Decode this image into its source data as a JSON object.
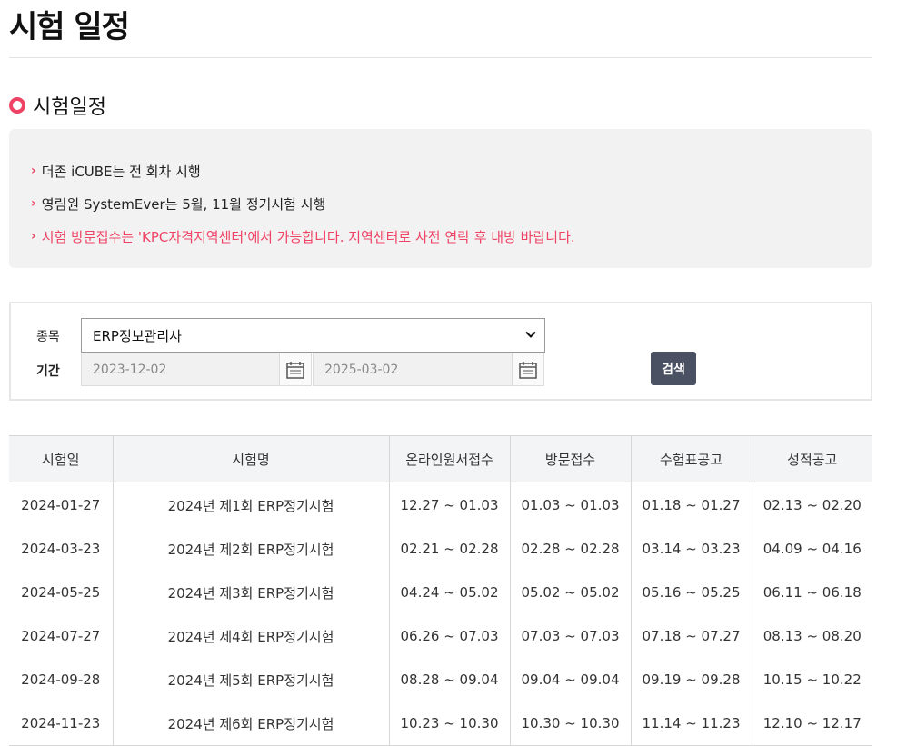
{
  "page": {
    "title": "시험 일정"
  },
  "section": {
    "title": "시험일정"
  },
  "notices": [
    "더존 iCUBE는 전 회차 시행",
    "영림원 SystemEver는 5월, 11월 정기시험 시행",
    "시험 방문접수는 'KPC자격지역센터'에서 가능합니다. 지역센터로 사전 연락 후 내방 바랍니다."
  ],
  "colors": {
    "accent": "#ef4365",
    "button": "#4a5162"
  },
  "search": {
    "category_label": "종목",
    "category_value": "ERP정보관리사",
    "period_label": "기간",
    "start_date": "2023-12-02",
    "end_date": "2025-03-02",
    "button_label": "검색"
  },
  "table": {
    "headers": [
      "시험일",
      "시험명",
      "온라인원서접수",
      "방문접수",
      "수험표공고",
      "성적공고"
    ],
    "rows": [
      [
        "2024-01-27",
        "2024년 제1회 ERP정기시험",
        "12.27 ~ 01.03",
        "01.03 ~ 01.03",
        "01.18 ~ 01.27",
        "02.13 ~ 02.20"
      ],
      [
        "2024-03-23",
        "2024년 제2회 ERP정기시험",
        "02.21 ~ 02.28",
        "02.28 ~ 02.28",
        "03.14 ~ 03.23",
        "04.09 ~ 04.16"
      ],
      [
        "2024-05-25",
        "2024년 제3회 ERP정기시험",
        "04.24 ~ 05.02",
        "05.02 ~ 05.02",
        "05.16 ~ 05.25",
        "06.11 ~ 06.18"
      ],
      [
        "2024-07-27",
        "2024년 제4회 ERP정기시험",
        "06.26 ~ 07.03",
        "07.03 ~ 07.03",
        "07.18 ~ 07.27",
        "08.13 ~ 08.20"
      ],
      [
        "2024-09-28",
        "2024년 제5회 ERP정기시험",
        "08.28 ~ 09.04",
        "09.04 ~ 09.04",
        "09.19 ~ 09.28",
        "10.15 ~ 10.22"
      ],
      [
        "2024-11-23",
        "2024년 제6회 ERP정기시험",
        "10.23 ~ 10.30",
        "10.30 ~ 10.30",
        "11.14 ~ 11.23",
        "12.10 ~ 12.17"
      ]
    ]
  }
}
